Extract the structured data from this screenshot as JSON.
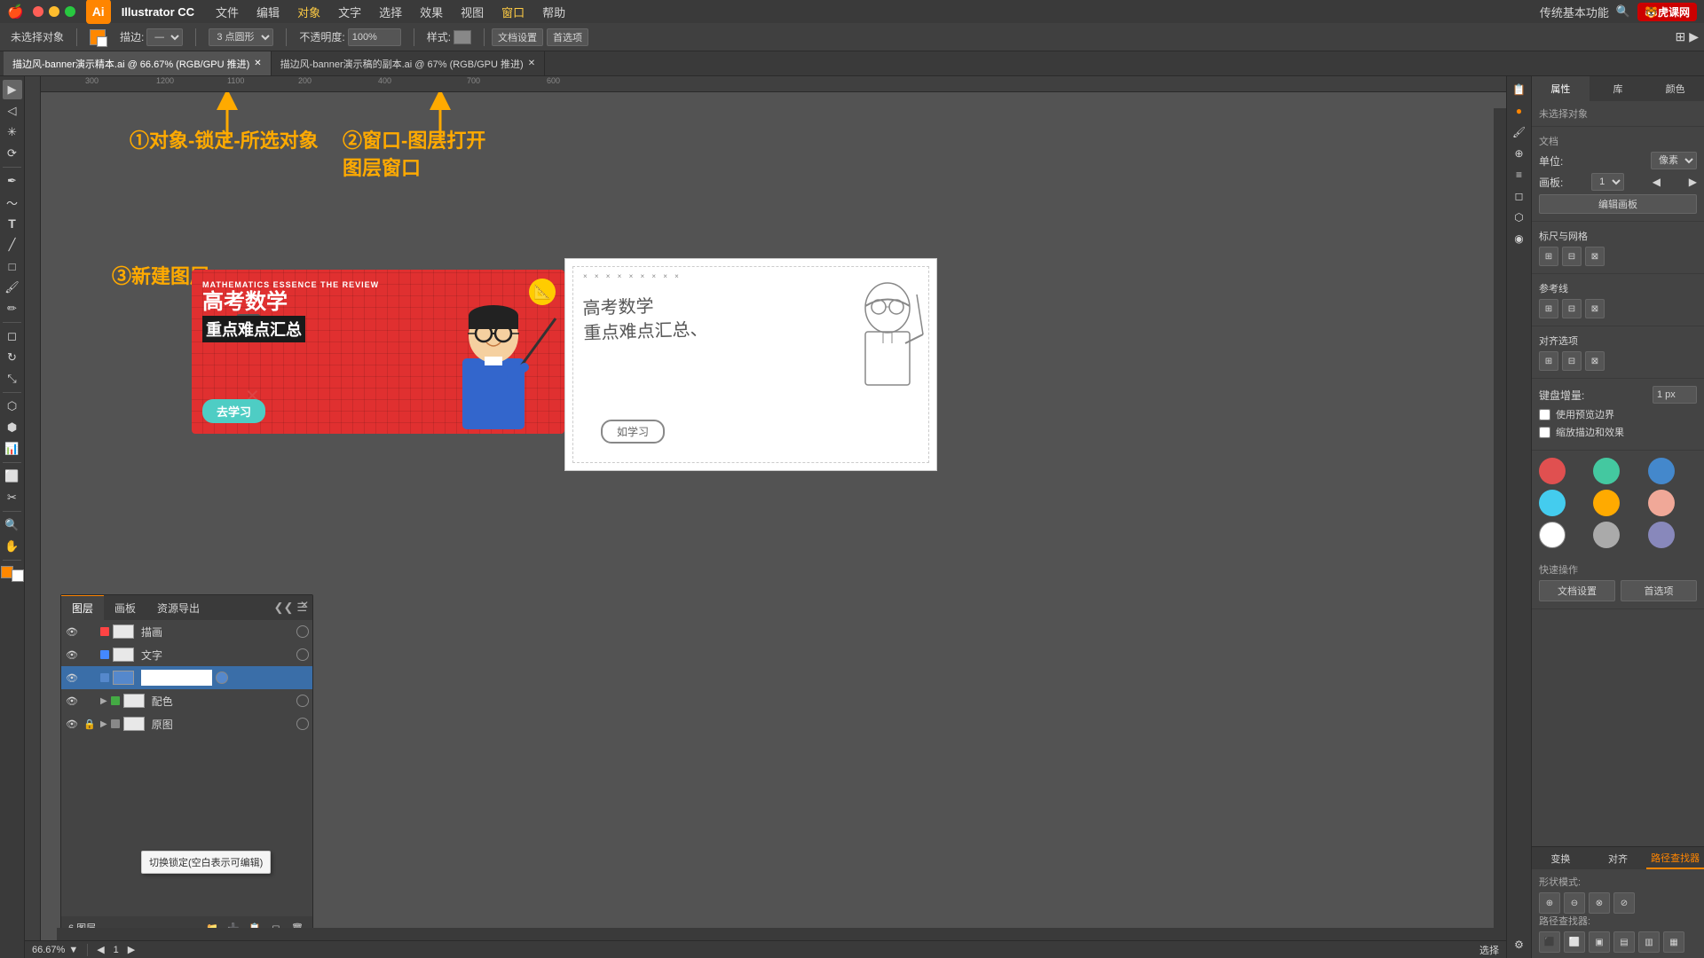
{
  "app": {
    "name": "Illustrator CC",
    "ai_logo": "Ai",
    "window_title": "传统基本功能"
  },
  "menu": {
    "apple": "🍎",
    "items": [
      "文件",
      "编辑",
      "对象",
      "文字",
      "选择",
      "效果",
      "视图",
      "窗口",
      "帮助"
    ]
  },
  "toolbar": {
    "no_selection": "未选择对象",
    "stroke_label": "描边:",
    "circle_type": "3 点圆形",
    "opacity_label": "不透明度:",
    "opacity_value": "100%",
    "style_label": "样式:",
    "doc_settings": "文档设置",
    "preferences": "首选项"
  },
  "tabs": [
    {
      "label": "描边风-banner演示精本.ai @ 66.67% (RGB/GPU 推进)",
      "active": true
    },
    {
      "label": "描边风-banner演示稿的副本.ai @ 67% (RGB/GPU 推进)",
      "active": false
    }
  ],
  "annotations": {
    "step1": "①对象-锁定-所选对象",
    "step2": "②窗口-图层打开图层窗口",
    "step3": "③新建图层",
    "arrow_up": "↑"
  },
  "layers_panel": {
    "tabs": [
      "图层",
      "画板",
      "资源导出"
    ],
    "layers": [
      {
        "name": "描画",
        "visible": true,
        "locked": false,
        "color": "#ff4444",
        "expanded": false
      },
      {
        "name": "文字",
        "visible": true,
        "locked": false,
        "color": "#4488ff",
        "expanded": false
      },
      {
        "name": "",
        "visible": true,
        "locked": false,
        "color": "#5588cc",
        "expanded": false,
        "editing": true
      },
      {
        "name": "配色",
        "visible": true,
        "locked": false,
        "color": "#44aa44",
        "expanded": true
      },
      {
        "name": "原图",
        "visible": true,
        "locked": true,
        "color": "#888888",
        "expanded": true
      }
    ],
    "footer_label": "6 图层",
    "tooltip": "切换锁定(空白表示可编辑)"
  },
  "right_panel": {
    "tabs": [
      "属性",
      "库",
      "颜色"
    ],
    "bottom_tabs": [
      "变换",
      "对齐",
      "路径查找器"
    ],
    "section_title": "未选择对象",
    "document": "文档",
    "unit_label": "单位:",
    "unit_value": "像素",
    "page_label": "画板:",
    "page_value": "1",
    "edit_artboard_btn": "编辑画板",
    "rulers_label": "标尺与网格",
    "guides_label": "参考线",
    "align_label": "对齐选项",
    "snap_label": "键盘增量:",
    "snap_value": "1 px",
    "use_preview": "使用预览边界",
    "round_corners": "缩放描边和效果",
    "quick_actions": "快速操作",
    "doc_settings_btn": "文档设置",
    "preferences_btn": "首选项",
    "colors": [
      {
        "color": "#e05050",
        "name": "red"
      },
      {
        "color": "#44c8a0",
        "name": "teal"
      },
      {
        "color": "#4488cc",
        "name": "blue"
      },
      {
        "color": "#44ccee",
        "name": "cyan"
      },
      {
        "color": "#ffaa00",
        "name": "orange"
      },
      {
        "color": "#f0a898",
        "name": "peach"
      },
      {
        "color": "#ffffff",
        "name": "white"
      },
      {
        "color": "#aaaaaa",
        "name": "gray"
      },
      {
        "color": "#8888bb",
        "name": "purple-gray"
      }
    ],
    "path_finder": {
      "title": "形状模式:",
      "title2": "路径查找器:"
    }
  },
  "bottom_bar": {
    "zoom": "66.67%",
    "artboard": "1",
    "tool": "选择"
  },
  "banner": {
    "subtitle": "MATHEMATICS ESSENCE THE REVIEW",
    "title_cn": "高考数学",
    "subtitle_cn": "重点难点汇总",
    "btn": "去学习"
  }
}
